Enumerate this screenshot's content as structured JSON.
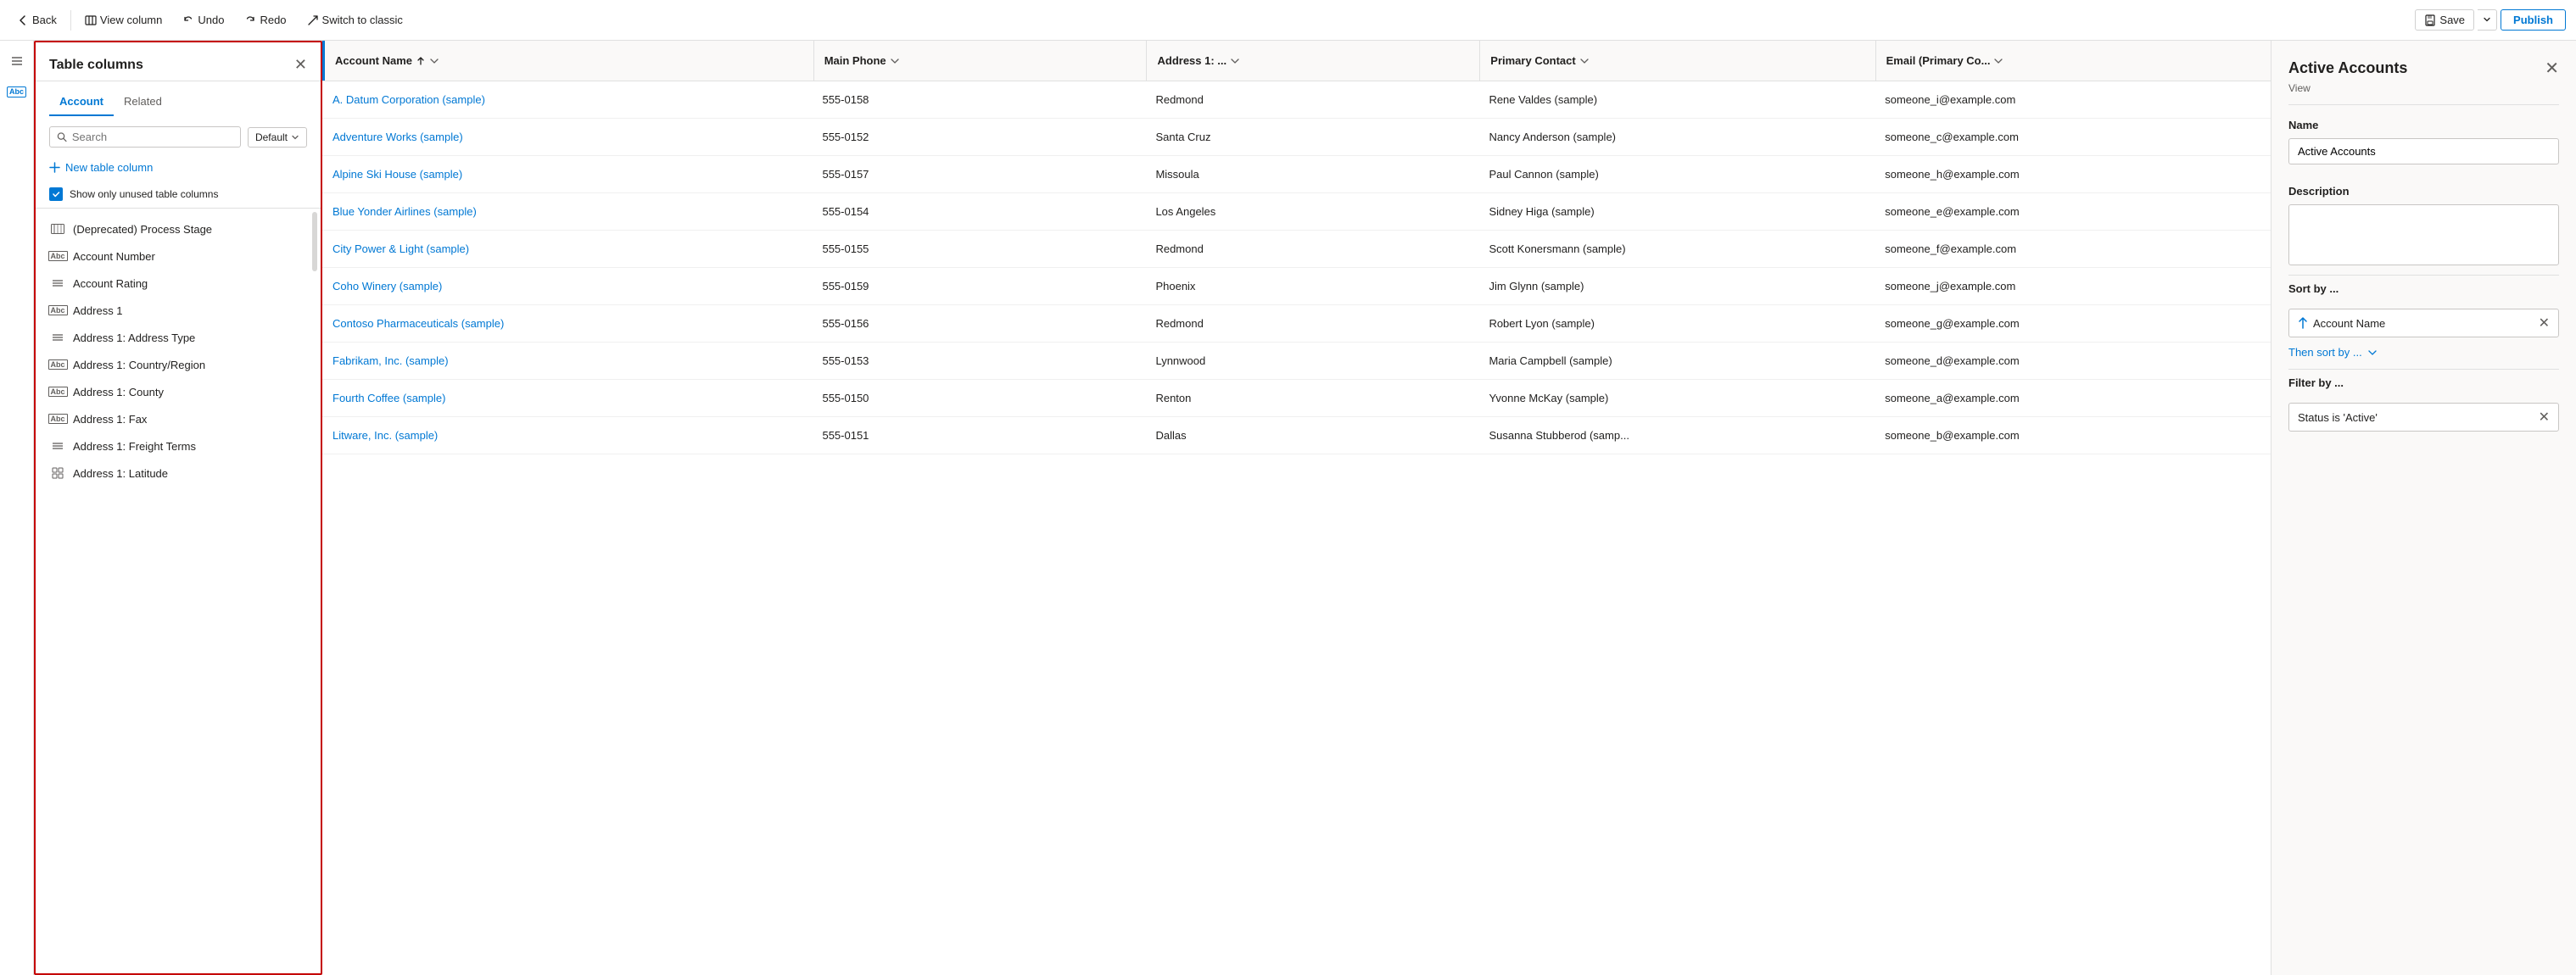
{
  "topbar": {
    "back_label": "Back",
    "view_column_label": "View column",
    "undo_label": "Undo",
    "redo_label": "Redo",
    "switch_label": "Switch to classic",
    "save_label": "Save",
    "publish_label": "Publish"
  },
  "panel": {
    "title": "Table columns",
    "tabs": [
      {
        "label": "Account",
        "active": true
      },
      {
        "label": "Related",
        "active": false
      }
    ],
    "search_placeholder": "Search",
    "default_label": "Default",
    "new_column_label": "New table column",
    "unused_label": "Show only unused table columns",
    "columns": [
      {
        "icon": "deprecated",
        "label": "(Deprecated) Process Stage"
      },
      {
        "icon": "abc",
        "label": "Account Number"
      },
      {
        "icon": "lines",
        "label": "Account Rating"
      },
      {
        "icon": "abc",
        "label": "Address 1"
      },
      {
        "icon": "lines",
        "label": "Address 1: Address Type"
      },
      {
        "icon": "abc",
        "label": "Address 1: Country/Region"
      },
      {
        "icon": "abc",
        "label": "Address 1: County"
      },
      {
        "icon": "abc",
        "label": "Address 1: Fax"
      },
      {
        "icon": "lines",
        "label": "Address 1: Freight Terms"
      },
      {
        "icon": "grid",
        "label": "Address 1: Latitude"
      }
    ]
  },
  "grid": {
    "headers": [
      {
        "label": "Account Name",
        "sort": true,
        "filter": true
      },
      {
        "label": "Main Phone",
        "filter": true
      },
      {
        "label": "Address 1: ...",
        "filter": true
      },
      {
        "label": "Primary Contact",
        "filter": true
      },
      {
        "label": "Email (Primary Co...",
        "filter": true
      }
    ],
    "rows": [
      {
        "name": "A. Datum Corporation (sample)",
        "phone": "555-0158",
        "address": "Redmond",
        "contact": "Rene Valdes (sample)",
        "email": "someone_i@example.com"
      },
      {
        "name": "Adventure Works (sample)",
        "phone": "555-0152",
        "address": "Santa Cruz",
        "contact": "Nancy Anderson (sample)",
        "email": "someone_c@example.com"
      },
      {
        "name": "Alpine Ski House (sample)",
        "phone": "555-0157",
        "address": "Missoula",
        "contact": "Paul Cannon (sample)",
        "email": "someone_h@example.com"
      },
      {
        "name": "Blue Yonder Airlines (sample)",
        "phone": "555-0154",
        "address": "Los Angeles",
        "contact": "Sidney Higa (sample)",
        "email": "someone_e@example.com"
      },
      {
        "name": "City Power & Light (sample)",
        "phone": "555-0155",
        "address": "Redmond",
        "contact": "Scott Konersmann (sample)",
        "email": "someone_f@example.com"
      },
      {
        "name": "Coho Winery (sample)",
        "phone": "555-0159",
        "address": "Phoenix",
        "contact": "Jim Glynn (sample)",
        "email": "someone_j@example.com"
      },
      {
        "name": "Contoso Pharmaceuticals (sample)",
        "phone": "555-0156",
        "address": "Redmond",
        "contact": "Robert Lyon (sample)",
        "email": "someone_g@example.com"
      },
      {
        "name": "Fabrikam, Inc. (sample)",
        "phone": "555-0153",
        "address": "Lynnwood",
        "contact": "Maria Campbell (sample)",
        "email": "someone_d@example.com"
      },
      {
        "name": "Fourth Coffee (sample)",
        "phone": "555-0150",
        "address": "Renton",
        "contact": "Yvonne McKay (sample)",
        "email": "someone_a@example.com"
      },
      {
        "name": "Litware, Inc. (sample)",
        "phone": "555-0151",
        "address": "Dallas",
        "contact": "Susanna Stubberod (samp...",
        "email": "someone_b@example.com"
      }
    ]
  },
  "right_panel": {
    "title": "Active Accounts",
    "subtitle": "View",
    "name_label": "Name",
    "name_value": "Active Accounts",
    "description_label": "Description",
    "description_placeholder": "",
    "sort_label": "Sort by ...",
    "sort_field": "Account Name",
    "then_sort_label": "Then sort by ...",
    "filter_label": "Filter by ...",
    "filter_value": "Status is 'Active'"
  },
  "icons": {
    "back": "←",
    "view_column": "⊞",
    "undo": "↩",
    "redo": "↪",
    "switch": "↗",
    "save_disk": "💾",
    "hamburger": "☰",
    "abc_badge": "Abc",
    "close": "✕",
    "check": "✓",
    "plus": "+",
    "sort_asc": "↑",
    "chevron_down": "∨",
    "sort_filter": "⊽",
    "grid_icon": "⊞"
  }
}
